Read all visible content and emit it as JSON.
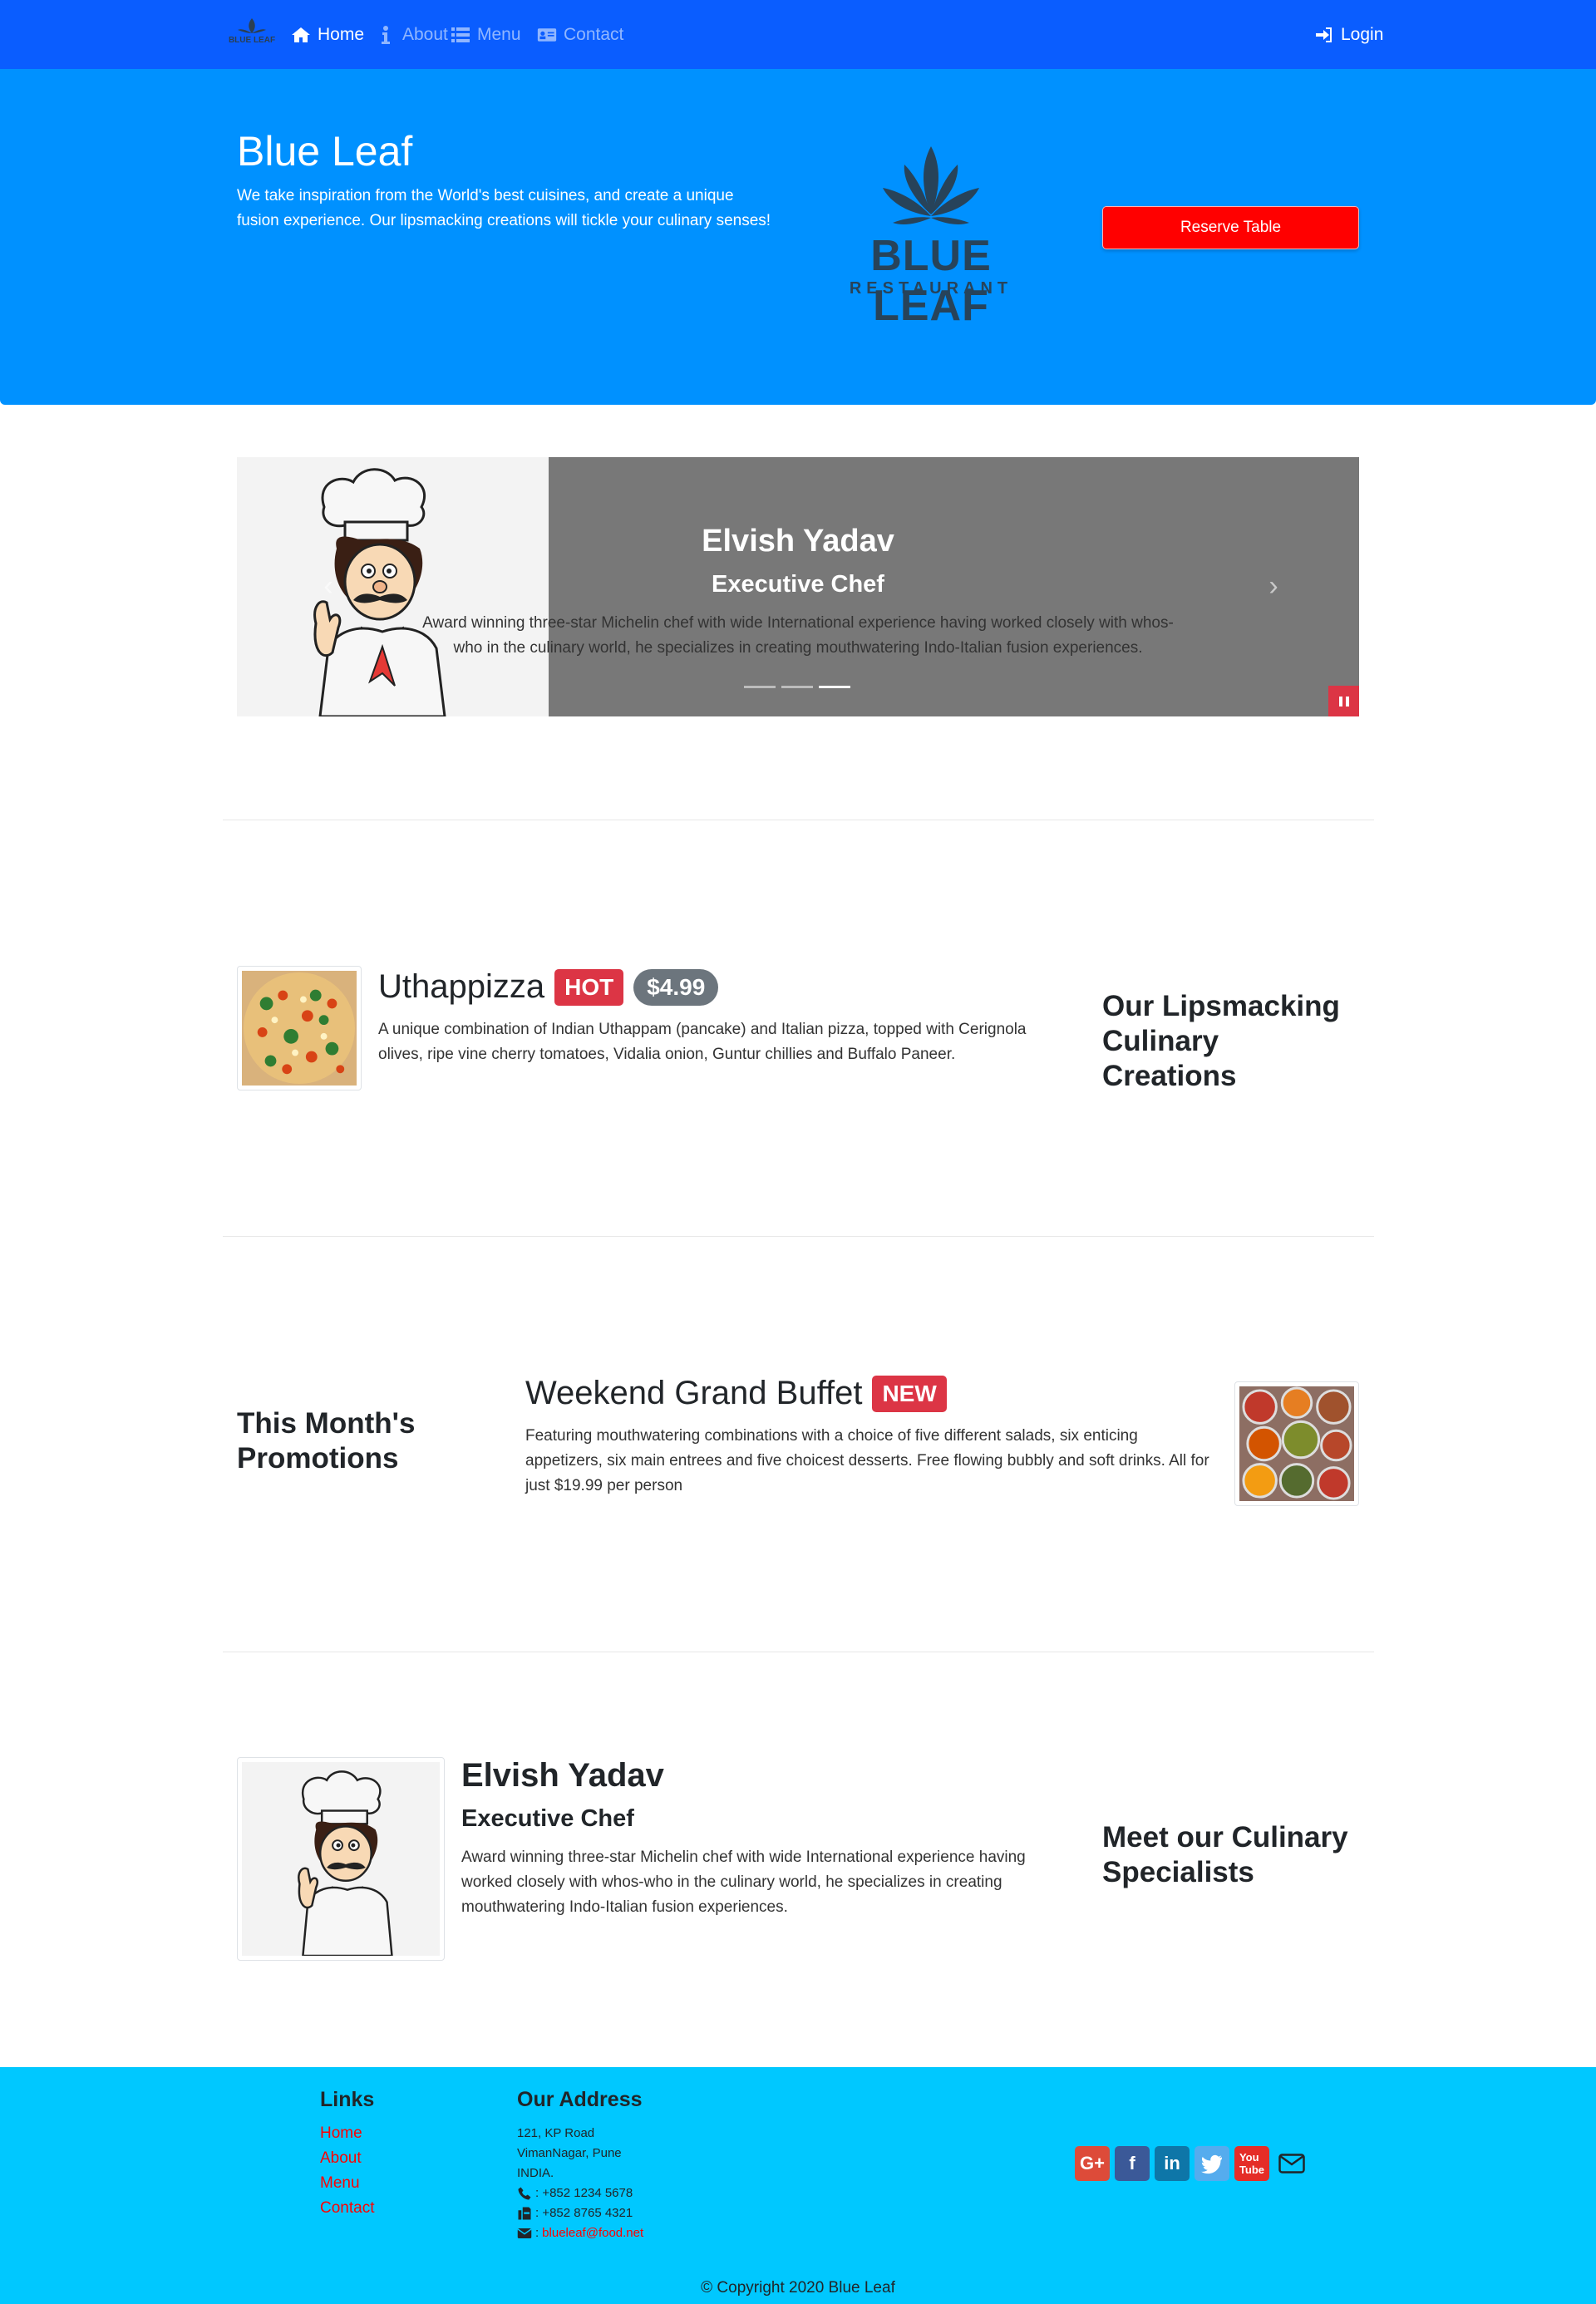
{
  "nav": {
    "home": "Home",
    "about": "About",
    "menu": "Menu",
    "contact": "Contact",
    "login": "Login",
    "logo_text": "BLUE LEAF"
  },
  "jumbotron": {
    "title": "Blue Leaf",
    "text": "We take inspiration from the World's best cuisines, and create a unique fusion experience. Our lipsmacking creations will tickle your culinary senses!",
    "logo_word": "BLUE LEAF",
    "logo_sub": "RESTAURANT",
    "reserve_label": "Reserve Table"
  },
  "carousel": {
    "name": "Elvish Yadav",
    "role": "Executive Chef",
    "description": "Award winning three-star Michelin chef with wide International experience having worked closely with whos-who in the culinary world, he specializes in creating mouthwatering Indo-Italian fusion experiences.",
    "indicator_count": 3,
    "active_indicator": 3
  },
  "dish": {
    "name": "Uthappizza",
    "badge": "HOT",
    "price": "$4.99",
    "description": "A unique combination of Indian Uthappam (pancake) and Italian pizza, topped with Cerignola olives, ripe vine cherry tomatoes, Vidalia onion, Guntur chillies and Buffalo Paneer.",
    "side_heading": "Our Lipsmacking Culinary Creations"
  },
  "promotion": {
    "name": "Weekend Grand Buffet",
    "badge": "NEW",
    "description": "Featuring mouthwatering combinations with a choice of five different salads, six enticing appetizers, six main entrees and five choicest desserts. Free flowing bubbly and soft drinks. All for just $19.99 per person",
    "side_heading": "This Month's Promotions"
  },
  "leader": {
    "name": "Elvish Yadav",
    "role": "Executive Chef",
    "description": "Award winning three-star Michelin chef with wide International experience having worked closely with whos-who in the culinary world, he specializes in creating mouthwatering Indo-Italian fusion experiences.",
    "side_heading": "Meet our Culinary Specialists"
  },
  "footer": {
    "links_heading": "Links",
    "links": [
      "Home",
      "About",
      "Menu",
      "Contact"
    ],
    "address_heading": "Our Address",
    "address_line1": "121, KP Road",
    "address_line2": "VimanNagar, Pune",
    "address_line3": "INDIA.",
    "phone": ": +852 1234 5678",
    "fax": ": +852 8765 4321",
    "email_prefix": ": ",
    "email": "blueleaf@food.net",
    "copyright": "© Copyright 2020 Blue Leaf",
    "social_icons": [
      "google-plus-icon",
      "facebook-icon",
      "linkedin-icon",
      "twitter-icon",
      "youtube-icon",
      "envelope-icon"
    ]
  },
  "colors": {
    "navbar": "#0a5dff",
    "jumbotron": "#0091ff",
    "footer": "#00c8ff",
    "reserve_button": "#ff0000",
    "badge_danger": "#dc3545",
    "badge_secondary": "#6c757d",
    "link": "#ff0000"
  }
}
